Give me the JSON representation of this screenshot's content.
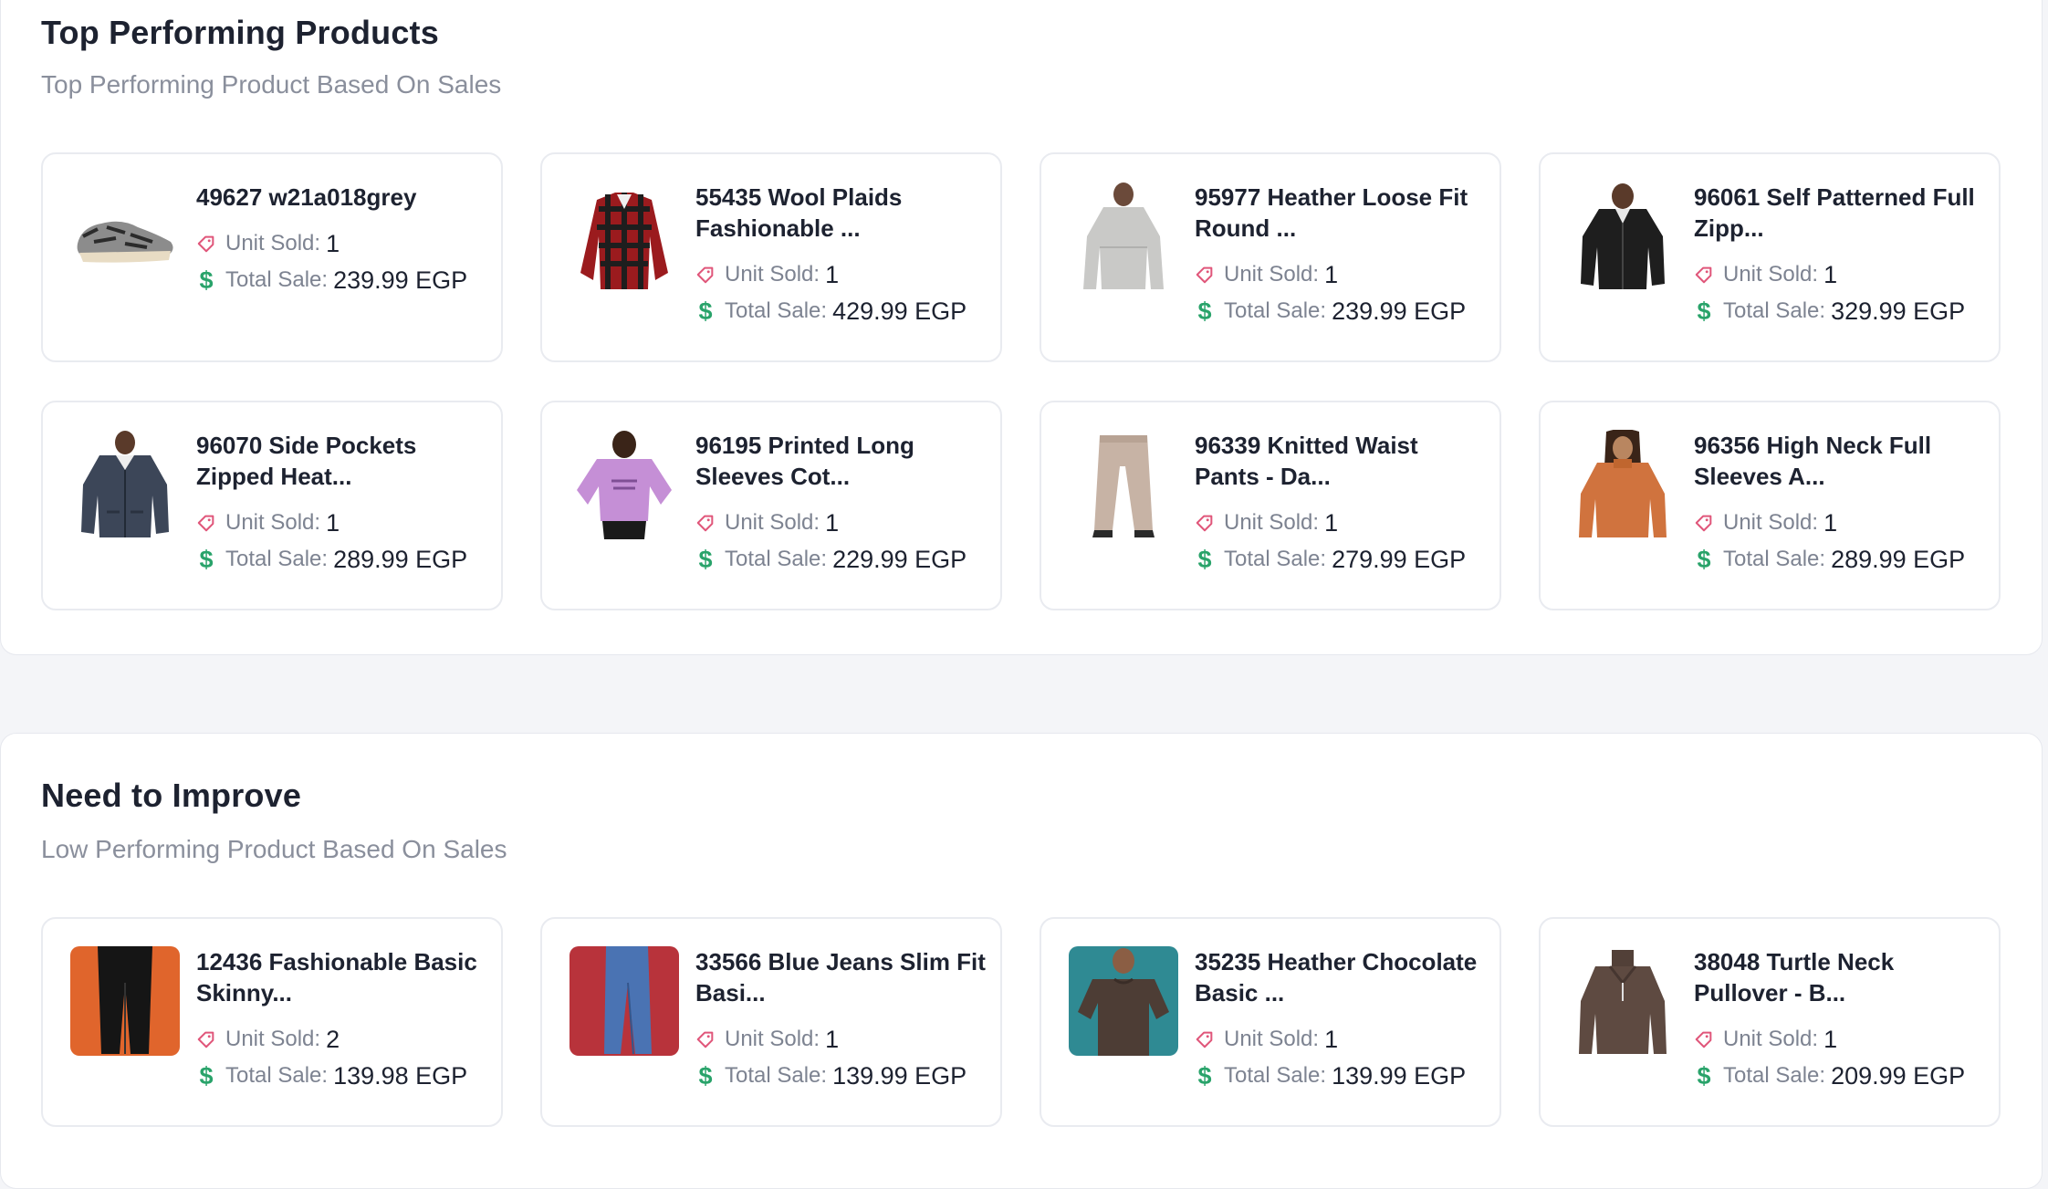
{
  "sections": [
    {
      "title": "Top Performing Products",
      "subtitle": "Top Performing Product Based On Sales",
      "products": [
        {
          "name": "49627 w21a018grey",
          "unit_label": "Unit Sold:",
          "units": "1",
          "total_label": "Total Sale:",
          "total": "239.99 EGP",
          "image": "sneaker"
        },
        {
          "name": "55435 Wool Plaids Fashionable ...",
          "unit_label": "Unit Sold:",
          "units": "1",
          "total_label": "Total Sale:",
          "total": "429.99 EGP",
          "image": "plaid-shirt"
        },
        {
          "name": "95977 Heather Loose Fit Round ...",
          "unit_label": "Unit Sold:",
          "units": "1",
          "total_label": "Total Sale:",
          "total": "239.99 EGP",
          "image": "grey-sweater"
        },
        {
          "name": "96061 Self Patterned Full Zipp...",
          "unit_label": "Unit Sold:",
          "units": "1",
          "total_label": "Total Sale:",
          "total": "329.99 EGP",
          "image": "black-hoodie"
        },
        {
          "name": "96070 Side Pockets Zipped Heat...",
          "unit_label": "Unit Sold:",
          "units": "1",
          "total_label": "Total Sale:",
          "total": "289.99 EGP",
          "image": "navy-hoodie"
        },
        {
          "name": "96195 Printed Long Sleeves Cot...",
          "unit_label": "Unit Sold:",
          "units": "1",
          "total_label": "Total Sale:",
          "total": "229.99 EGP",
          "image": "purple-sweatshirt"
        },
        {
          "name": "96339 Knitted Waist Pants - Da...",
          "unit_label": "Unit Sold:",
          "units": "1",
          "total_label": "Total Sale:",
          "total": "279.99 EGP",
          "image": "beige-pants"
        },
        {
          "name": "96356 High Neck Full Sleeves A...",
          "unit_label": "Unit Sold:",
          "units": "1",
          "total_label": "Total Sale:",
          "total": "289.99 EGP",
          "image": "orange-sweater"
        }
      ]
    },
    {
      "title": "Need to Improve",
      "subtitle": "Low Performing Product Based On Sales",
      "products": [
        {
          "name": "12436 Fashionable Basic Skinny...",
          "unit_label": "Unit Sold:",
          "units": "2",
          "total_label": "Total Sale:",
          "total": "139.98 EGP",
          "image": "black-skinny-jeans"
        },
        {
          "name": "33566 Blue Jeans Slim Fit Basi...",
          "unit_label": "Unit Sold:",
          "units": "1",
          "total_label": "Total Sale:",
          "total": "139.99 EGP",
          "image": "blue-jeans"
        },
        {
          "name": "35235 Heather Chocolate Basic ...",
          "unit_label": "Unit Sold:",
          "units": "1",
          "total_label": "Total Sale:",
          "total": "139.99 EGP",
          "image": "chocolate-tee"
        },
        {
          "name": "38048 Turtle Neck Pullover - B...",
          "unit_label": "Unit Sold:",
          "units": "1",
          "total_label": "Total Sale:",
          "total": "209.99 EGP",
          "image": "turtleneck-pullover"
        }
      ]
    }
  ],
  "colors": {
    "tag_icon": "#e0567a",
    "dollar_icon": "#29a36a",
    "muted_text": "#8a8f9c",
    "card_border": "#e9ebf0"
  }
}
